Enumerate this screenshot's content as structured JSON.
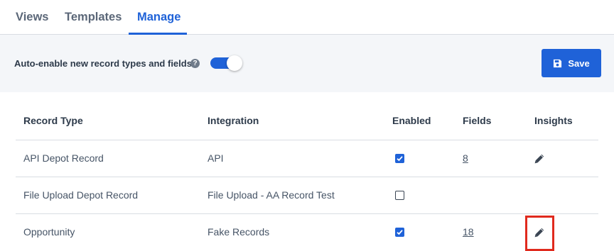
{
  "tabs": [
    {
      "label": "Views"
    },
    {
      "label": "Templates"
    },
    {
      "label": "Manage",
      "active": true
    }
  ],
  "toolbar": {
    "auto_enable_label": "Auto-enable new record types and fields",
    "help_icon": "question-circle-icon",
    "auto_enable_on": true,
    "save_label": "Save",
    "save_icon": "floppy-disk-icon"
  },
  "table": {
    "headers": {
      "record_type": "Record Type",
      "integration": "Integration",
      "enabled": "Enabled",
      "fields": "Fields",
      "insights": "Insights"
    },
    "rows": [
      {
        "record_type": "API Depot Record",
        "integration": "API",
        "enabled": true,
        "fields": "8",
        "insights_icon": "pencil-icon"
      },
      {
        "record_type": "File Upload Depot Record",
        "integration": "File Upload - AA Record Test",
        "enabled": false,
        "fields": "",
        "insights_icon": ""
      },
      {
        "record_type": "Opportunity",
        "integration": "Fake Records",
        "enabled": true,
        "fields": "18",
        "insights_icon": "pencil-icon",
        "highlighted": true
      }
    ]
  },
  "colors": {
    "accent": "#1f62d8",
    "highlight": "#e02a1e",
    "toolbar_bg": "#f4f6f9"
  }
}
